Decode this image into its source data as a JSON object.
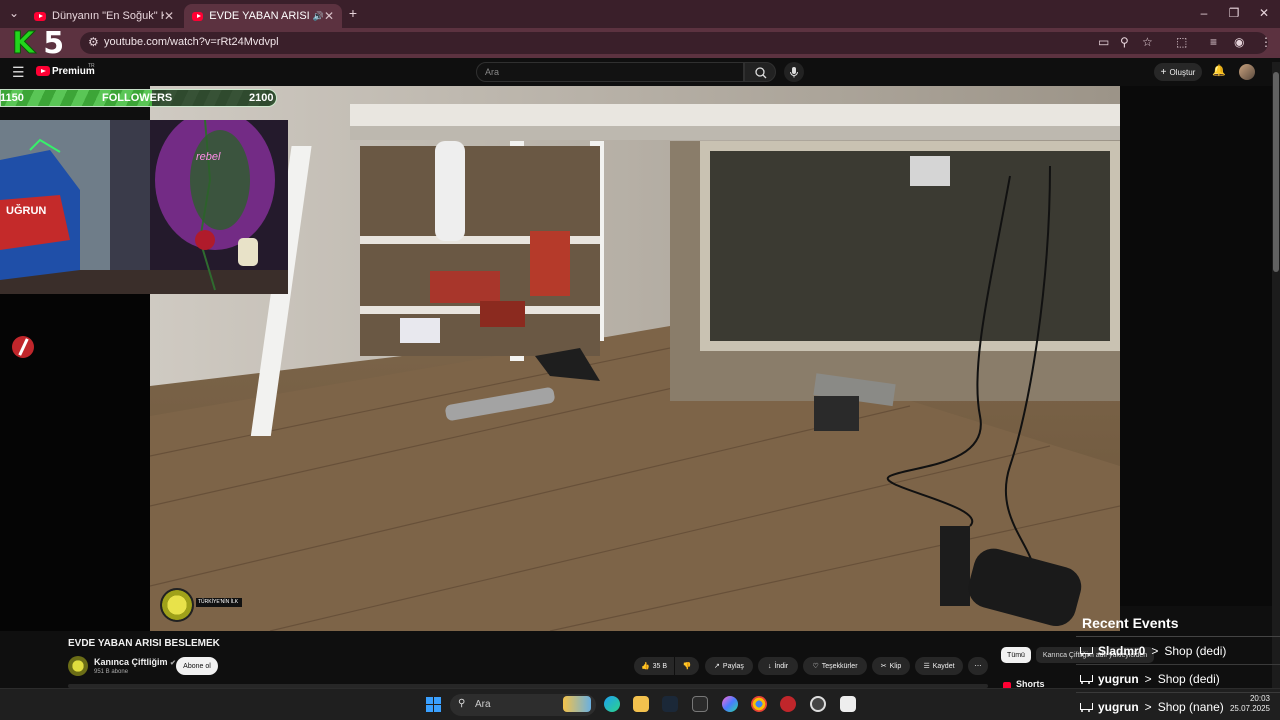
{
  "browser": {
    "tabs": [
      {
        "label": "Dünyanın \"En Soğuk\" Köyüne Y"
      },
      {
        "label": "EVDE YABAN ARISI BESLEM"
      }
    ],
    "url": "youtube.com/watch?v=rRt24Mvdvpl"
  },
  "overlay": {
    "logo_letter": "K",
    "logo_number": "5",
    "followers_start": "1150",
    "followers_label": "FOLLOWERS",
    "followers_goal": "2100",
    "followers_progress": 0.55,
    "badge_text": "TÜRKİYE'NİN İLK"
  },
  "youtube": {
    "brand": "Premium",
    "country": "TR",
    "search_placeholder": "Ara",
    "create_label": "Oluştur"
  },
  "video": {
    "title": "EVDE YABAN ARISI BESLEMEK",
    "channel": "Kanınca Çiftliğim",
    "subscribers": "951 B abone",
    "subscribe_label": "Abone ol",
    "likes": "35 B",
    "share_label": "Paylaş",
    "download_label": "İndir",
    "thanks_label": "Teşekkürler",
    "clip_label": "Klip",
    "save_label": "Kaydet"
  },
  "sidebar_chips": {
    "all": "Tümü",
    "channel": "Karınca Çiftliğim adlı yükleyiciden",
    "shorts": "Shorts"
  },
  "recent_events": {
    "title": "Recent Events",
    "items": [
      {
        "user": "Sladmr0",
        "arrow": ">",
        "action": "Shop (dedi)"
      },
      {
        "user": "yugrun",
        "arrow": ">",
        "action": "Shop (dedi)"
      },
      {
        "user": "yugrun",
        "arrow": ">",
        "action": "Shop (nane)"
      }
    ]
  },
  "taskbar": {
    "search_placeholder": "Ara",
    "time": "20:03",
    "date": "25.07.2025"
  },
  "colors": {
    "youtube_red": "#ff0033",
    "browser_frame": "#5c3240",
    "follower_green": "#5fd05a"
  }
}
